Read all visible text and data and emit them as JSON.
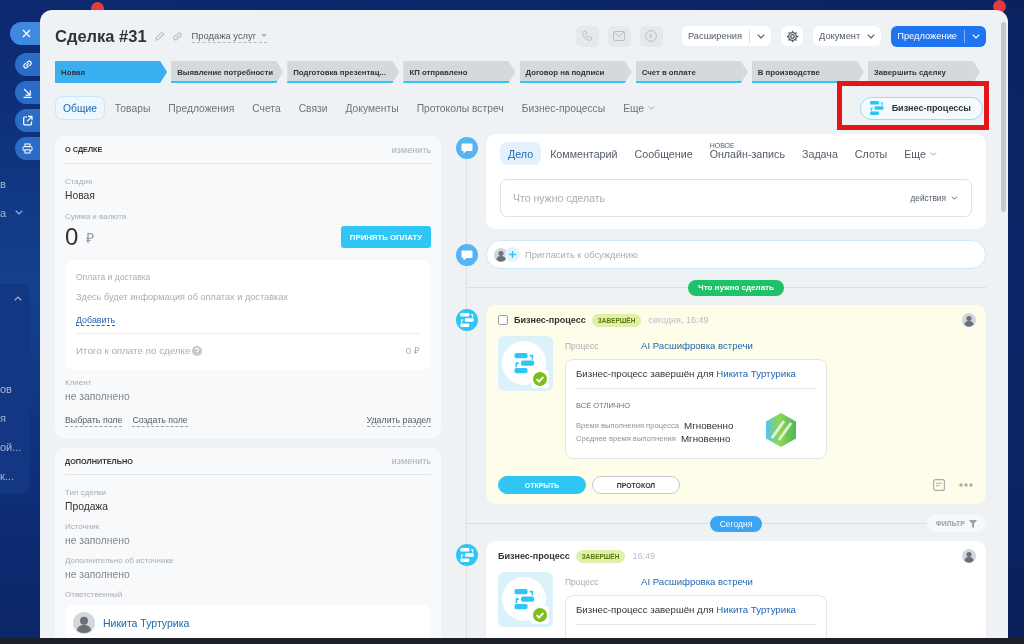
{
  "backdrop_menu": {
    "items": [
      {
        "label": "в",
        "kind": "item"
      },
      {
        "label": "а",
        "kind": "group"
      }
    ],
    "open_group": {
      "expanded": true,
      "items": [
        {
          "label": "ов"
        },
        {
          "label": "я"
        },
        {
          "label": "ой..."
        },
        {
          "label": "к..."
        }
      ]
    }
  },
  "deal": {
    "title": "Сделка #31",
    "category": "Продажа услуг",
    "contact_buttons": [
      {
        "kind": "phone",
        "disabled": true
      },
      {
        "kind": "mail",
        "disabled": true
      },
      {
        "kind": "chat",
        "disabled": true
      }
    ],
    "extensions_button": "Расширения",
    "document_button": "Документ",
    "offer_button": "Предложение"
  },
  "stages": [
    {
      "label": "Новая",
      "selected": true,
      "kind": "stage"
    },
    {
      "label": "Выявление потребности",
      "selected": false,
      "kind": "stage"
    },
    {
      "label": "Подготовка презентац...",
      "selected": false,
      "kind": "stage"
    },
    {
      "label": "КП отправлено",
      "selected": false,
      "kind": "stage"
    },
    {
      "label": "Договор на подписи",
      "selected": false,
      "kind": "stage"
    },
    {
      "label": "Счет в оплате",
      "selected": false,
      "kind": "stage"
    },
    {
      "label": "В производстве",
      "selected": false,
      "kind": "stage"
    },
    {
      "label": "Завершить сделку",
      "selected": false,
      "kind": "final"
    }
  ],
  "tabs": [
    {
      "label": "Общие",
      "selected": true,
      "kind": "tab"
    },
    {
      "label": "Товары",
      "selected": false,
      "kind": "tab"
    },
    {
      "label": "Предложения",
      "selected": false,
      "kind": "tab"
    },
    {
      "label": "Счета",
      "selected": false,
      "kind": "tab"
    },
    {
      "label": "Связи",
      "selected": false,
      "kind": "tab"
    },
    {
      "label": "Документы",
      "selected": false,
      "kind": "tab"
    },
    {
      "label": "Протоколы встреч",
      "selected": false,
      "kind": "tab"
    },
    {
      "label": "Бизнес-процессы",
      "selected": false,
      "kind": "tab"
    },
    {
      "label": "Еще",
      "selected": false,
      "kind": "more"
    }
  ],
  "process_button": {
    "label": "Бизнес-процессы",
    "highlighted": true
  },
  "sections": [
    {
      "title": "О СДЕЛКЕ",
      "edit_link": "изменить",
      "fields": [
        {
          "kind": "text",
          "label": "Стадия",
          "value": "Новая",
          "empty": false
        },
        {
          "kind": "money",
          "label": "Сумма и валюта",
          "amount": "0",
          "currency": "₽",
          "button": "ПРИНЯТЬ ОПЛАТУ"
        },
        {
          "kind": "payments",
          "title": "Оплата и доставка",
          "text": "Здесь будет информация об оплатах и доставках",
          "link": "Добавить",
          "total_label": "Итого к оплате по сделке",
          "total": "0 ₽"
        },
        {
          "kind": "text",
          "label": "Клиент",
          "value": "не заполнено",
          "empty": true
        }
      ],
      "footer_links": [
        "Выбрать поле",
        "Создать поле"
      ],
      "delete_link": "Удалить раздел"
    },
    {
      "title": "ДОПОЛНИТЕЛЬНО",
      "edit_link": "изменить",
      "fields": [
        {
          "kind": "text",
          "label": "Тип сделки",
          "value": "Продажа",
          "empty": false
        },
        {
          "kind": "text",
          "label": "Источник",
          "value": "не заполнено",
          "empty": true
        },
        {
          "kind": "text",
          "label": "Дополнительно об источнике",
          "value": "не заполнено",
          "empty": true
        },
        {
          "kind": "person",
          "label": "Ответственный",
          "name": "Никита Туртурика"
        }
      ]
    }
  ],
  "timeline": {
    "editor": {
      "tabs": [
        {
          "label": "Дело",
          "selected": true,
          "kind": "tab"
        },
        {
          "label": "Комментарий",
          "selected": false,
          "kind": "tab"
        },
        {
          "label": "Сообщение",
          "selected": false,
          "kind": "tab"
        },
        {
          "label": "Онлайн-запись",
          "selected": false,
          "kind": "tab",
          "tag": "НОВОЕ"
        },
        {
          "label": "Задача",
          "selected": false,
          "kind": "tab"
        },
        {
          "label": "Слоты",
          "selected": false,
          "kind": "tab"
        },
        {
          "label": "Еще",
          "selected": false,
          "kind": "more"
        }
      ],
      "placeholder": "Что нужно сделать",
      "actions": "действия"
    },
    "invite": {
      "placeholder": "Пригласить к обсуждению"
    },
    "entries": [
      {
        "kind": "divider",
        "label": "Что нужно сделать",
        "color": "#1fc16b"
      },
      {
        "kind": "activity",
        "checked": false,
        "title": "Бизнес-процесс",
        "status": "ЗАВЕРШЁН",
        "time": "сегодня, 16:49",
        "process_label": "Процесс",
        "process_name": "AI Расшифровка встречи",
        "result_text": "Бизнес-процесс завершён для",
        "result_person": "Никита Туртурика",
        "summary": "ВСЁ ОТЛИЧНО",
        "stats": [
          {
            "label": "Время выполнения процесса",
            "value": "Мгновенно"
          },
          {
            "label": "Среднее время выполнения",
            "value": "Мгновенно"
          }
        ],
        "buttons": [
          {
            "label": "ОТКРЫТЬ",
            "primary": true
          },
          {
            "label": "ПРОТОКОЛ",
            "primary": false
          }
        ]
      },
      {
        "kind": "divider",
        "label": "Сегодня",
        "color": "#3ba4f3",
        "filter": "ФИЛЬТР"
      },
      {
        "kind": "history",
        "title": "Бизнес-процесс",
        "status": "ЗАВЕРШЁН",
        "time": "16:49",
        "process_label": "Процесс",
        "process_name": "AI Расшифровка встречи",
        "result_text": "Бизнес-процесс завершён для",
        "result_person": "Никита Туртурика"
      }
    ]
  }
}
